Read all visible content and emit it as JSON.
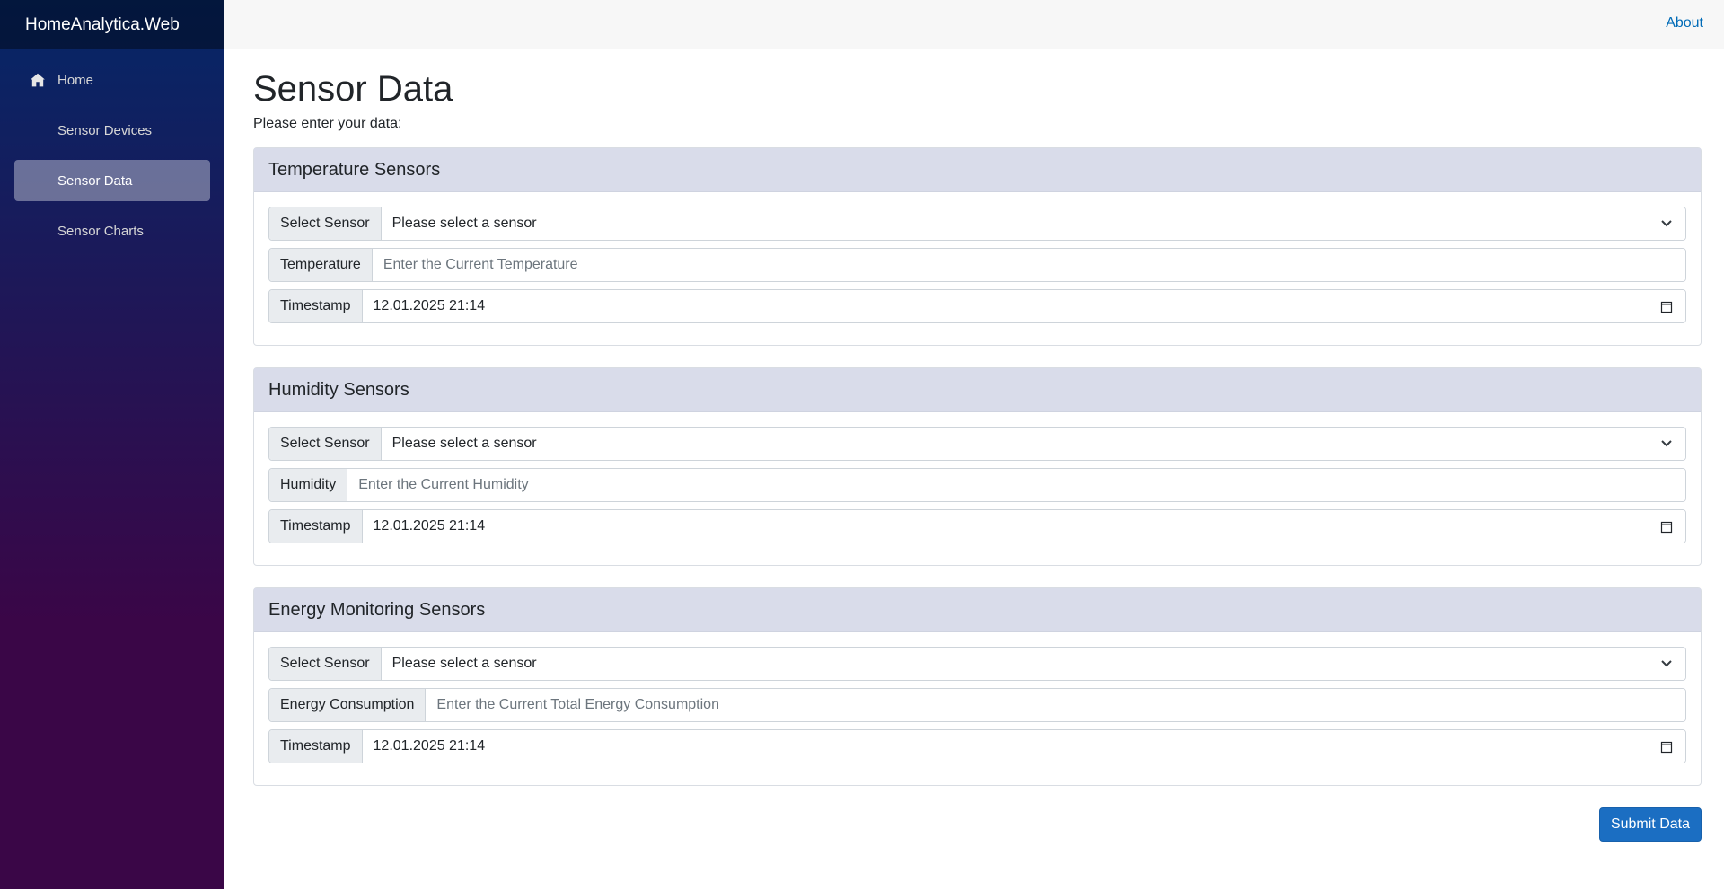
{
  "brand": "HomeAnalytica.Web",
  "nav": {
    "items": [
      {
        "label": "Home",
        "icon": "home-icon"
      },
      {
        "label": "Sensor Devices"
      },
      {
        "label": "Sensor Data",
        "active": true
      },
      {
        "label": "Sensor Charts"
      }
    ]
  },
  "topbar": {
    "about": "About"
  },
  "page": {
    "title": "Sensor Data",
    "intro": "Please enter your data:"
  },
  "sections": [
    {
      "header": "Temperature Sensors",
      "select_label": "Select Sensor",
      "select_value": "Please select a sensor",
      "value_label": "Temperature",
      "value_placeholder": "Enter the Current Temperature",
      "timestamp_label": "Timestamp",
      "timestamp_value": "12.01.2025 21:14"
    },
    {
      "header": "Humidity Sensors",
      "select_label": "Select Sensor",
      "select_value": "Please select a sensor",
      "value_label": "Humidity",
      "value_placeholder": "Enter the Current Humidity",
      "timestamp_label": "Timestamp",
      "timestamp_value": "12.01.2025 21:14"
    },
    {
      "header": "Energy Monitoring Sensors",
      "select_label": "Select Sensor",
      "select_value": "Please select a sensor",
      "value_label": "Energy Consumption",
      "value_placeholder": "Enter the Current Total Energy Consumption",
      "timestamp_label": "Timestamp",
      "timestamp_value": "12.01.2025 21:14"
    }
  ],
  "submit_label": "Submit Data",
  "colors": {
    "sidebar_top": "#052767",
    "sidebar_bottom": "#3a0647",
    "primary": "#1b6ec2",
    "link": "#006bb7",
    "card_header": "#d9dcea"
  }
}
